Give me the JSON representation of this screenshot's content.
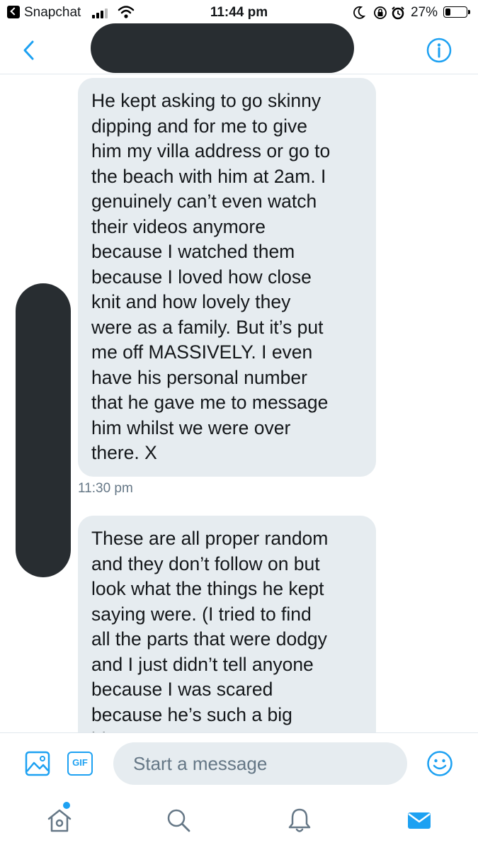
{
  "status_bar": {
    "back_app_label": "Snapchat",
    "time": "11:44 pm",
    "battery_percent_text": "27%",
    "battery_level": 0.27
  },
  "nav": {
    "back_icon": "chevron-left-icon",
    "info_icon": "info-icon"
  },
  "messages": [
    {
      "text": "He kept asking to go skinny\ndipping and for me to give\nhim my villa address or go to\nthe beach with him at 2am. I\ngenuinely can’t even watch\ntheir videos anymore\nbecause I watched them\nbecause I loved how close\nknit and how lovely they\nwere as a family. But it’s put\nme off MASSIVELY. I even\nhave his personal number\nthat he gave me to message\nhim whilst we were over\nthere. X",
      "timestamp": "11:30 pm"
    },
    {
      "text": "These are all proper random\nand they don’t follow on but\nlook what the things he kept\nsaying were. (I tried to find\nall the parts that were dodgy\nand I just didn’t tell anyone\nbecause I was scared\nbecause he’s such a big\nbig name"
    }
  ],
  "composer": {
    "placeholder": "Start a message",
    "gif_label": "GIF"
  },
  "colors": {
    "accent": "#1da1f2",
    "bubble": "#e6ecf0",
    "redaction": "#282d31",
    "timestamp": "#657786"
  },
  "tabs": [
    {
      "icon": "home-icon",
      "has_notification_dot": true
    },
    {
      "icon": "search-icon"
    },
    {
      "icon": "bell-icon"
    },
    {
      "icon": "mail-icon",
      "active": true
    }
  ]
}
